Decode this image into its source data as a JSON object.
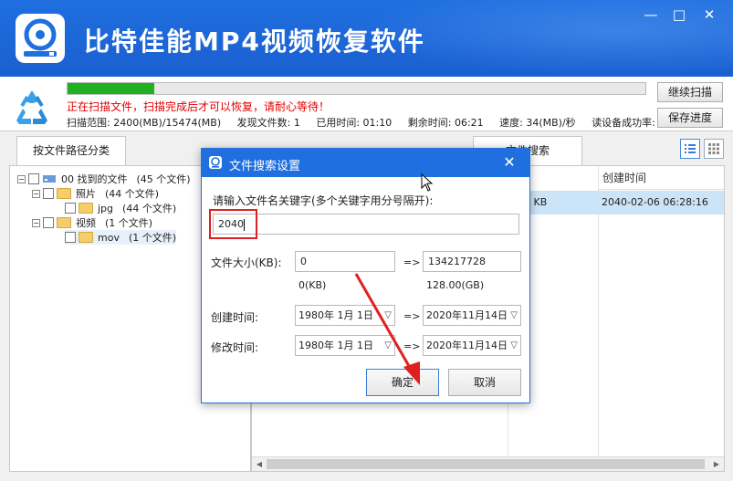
{
  "app": {
    "title": "比特佳能MP4视频恢复软件",
    "colors": {
      "brand": "#1f6fe0",
      "progress": "#1fb01f",
      "warning": "#e00000",
      "selection": "#cce4f7",
      "annotation": "#e02020"
    },
    "window_controls": {
      "minimize": "—",
      "maximize": "□",
      "close": "✕"
    }
  },
  "scan": {
    "progress": 0.15,
    "message": "正在扫描文件，扫描完成后才可以恢复，请耐心等待！",
    "range": "扫描范围: 2400(MB)/15474(MB)",
    "found": "发现文件数: 1",
    "elapsed": "已用时间: 01:10",
    "remaining": "剩余时间: 06:21",
    "speed": "速度: 34(MB)/秒",
    "success_rate": "读设备成功率:",
    "continue_button": "继续扫描",
    "save_button": "保存进度"
  },
  "tabs": {
    "left": "按文件路径分类",
    "right": "文件搜索"
  },
  "tree": {
    "expander_open": "−",
    "items": [
      {
        "name": "00 找到的文件",
        "count": "(45 个文件)"
      },
      {
        "name": "照片",
        "count": "(44 个文件)"
      },
      {
        "name": "jpg",
        "count": "(44 个文件)"
      },
      {
        "name": "视频",
        "count": "(1 个文件)"
      },
      {
        "name": "mov",
        "count": "(1 个文件)"
      }
    ]
  },
  "table": {
    "columns": [
      "创建时间"
    ],
    "rows": [
      {
        "size": "01 KB",
        "created": "2040-02-06   06:28:16"
      }
    ]
  },
  "dialog": {
    "title": "文件搜索设置",
    "close": "✕",
    "keyword_label": "请输入文件名关键字(多个关键字用分号隔开):",
    "keyword_value": "2040",
    "size_label": "文件大小(KB):",
    "size_min": "0",
    "size_max": "134217728",
    "size_min_hint": "0(KB)",
    "size_max_hint": "128.00(GB)",
    "arrow": "=>",
    "created_label": "创建时间:",
    "modified_label": "修改时间:",
    "date_from": "1980年  1月  1日",
    "date_to": "2020年11月14日",
    "ok": "确定",
    "cancel": "取消"
  }
}
